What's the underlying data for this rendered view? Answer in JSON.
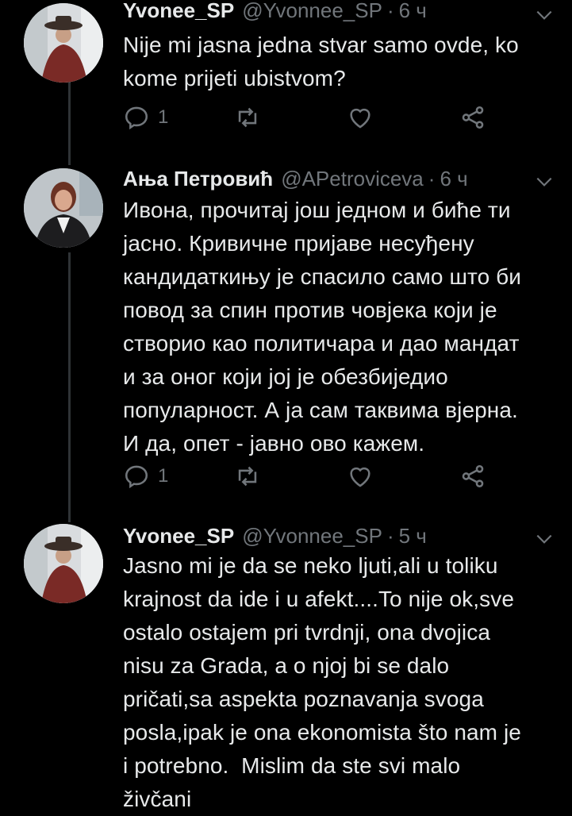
{
  "tweets": [
    {
      "name": "Yvonee_SP",
      "handle": "@Yvonnee_SP",
      "separator": "·",
      "time": "6 ч",
      "text": "Nije mi jasna jedna stvar samo ovde, ko\nkome prijeti ubistvom?",
      "reply_count": "1"
    },
    {
      "name": "Ања Петровић",
      "handle": "@APetroviceva",
      "separator": "·",
      "time": "6 ч",
      "text": "Ивона, прочитај још једном и биће ти\nјасно. Кривичне пријаве несуђену\nкандидаткињу је спасило само што би\nповод за спин против човјека који је\nстворио као политичара и дао мандат\nи за оног који јој је обезбиједио\nпопуларност. А ја сам таквима вјерна.\nИ да, опет - јавно ово кажем.",
      "reply_count": "1"
    },
    {
      "name": "Yvonee_SP",
      "handle": "@Yvonnee_SP",
      "separator": "·",
      "time": "5 ч",
      "text": "Jasno mi je da se neko ljuti,ali u toliku\nkrajnost da ide i u afekt....To nije ok,sve\nostalo ostajem pri tvrdnji, ona dvojica\nnisu za Grada, a o njoj bi se dalo\npričati,sa aspekta poznavanja svoga\nposla,ipak je ona ekonomista što nam je\ni potrebno.  Mislim da ste svi malo\nživčani"
    }
  ],
  "icons": {
    "reply": "reply-icon",
    "retweet": "retweet-icon",
    "like": "like-icon",
    "share": "share-icon",
    "caret": "chevron-down-icon"
  },
  "colors": {
    "background": "#000000",
    "text": "#e7e9ea",
    "muted": "#71767b",
    "thread_line": "#2f3336"
  }
}
